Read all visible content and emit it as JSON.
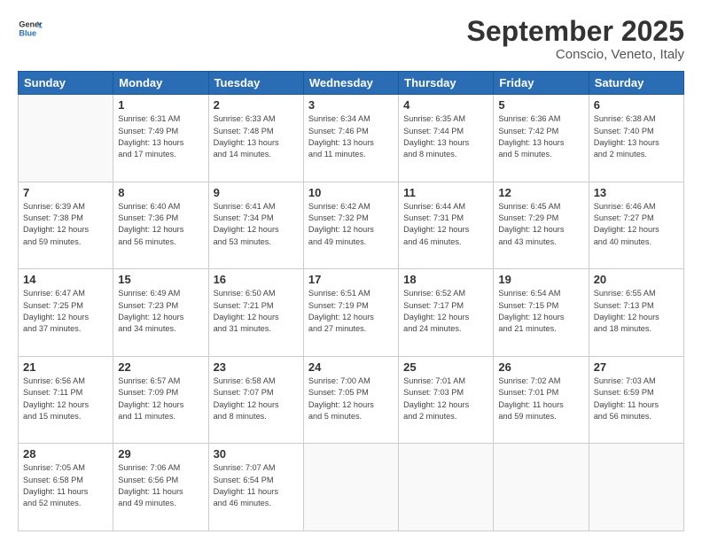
{
  "header": {
    "logo_general": "General",
    "logo_blue": "Blue",
    "month_title": "September 2025",
    "location": "Conscio, Veneto, Italy"
  },
  "days_of_week": [
    "Sunday",
    "Monday",
    "Tuesday",
    "Wednesday",
    "Thursday",
    "Friday",
    "Saturday"
  ],
  "weeks": [
    [
      {
        "day": "",
        "info": ""
      },
      {
        "day": "1",
        "info": "Sunrise: 6:31 AM\nSunset: 7:49 PM\nDaylight: 13 hours\nand 17 minutes."
      },
      {
        "day": "2",
        "info": "Sunrise: 6:33 AM\nSunset: 7:48 PM\nDaylight: 13 hours\nand 14 minutes."
      },
      {
        "day": "3",
        "info": "Sunrise: 6:34 AM\nSunset: 7:46 PM\nDaylight: 13 hours\nand 11 minutes."
      },
      {
        "day": "4",
        "info": "Sunrise: 6:35 AM\nSunset: 7:44 PM\nDaylight: 13 hours\nand 8 minutes."
      },
      {
        "day": "5",
        "info": "Sunrise: 6:36 AM\nSunset: 7:42 PM\nDaylight: 13 hours\nand 5 minutes."
      },
      {
        "day": "6",
        "info": "Sunrise: 6:38 AM\nSunset: 7:40 PM\nDaylight: 13 hours\nand 2 minutes."
      }
    ],
    [
      {
        "day": "7",
        "info": "Sunrise: 6:39 AM\nSunset: 7:38 PM\nDaylight: 12 hours\nand 59 minutes."
      },
      {
        "day": "8",
        "info": "Sunrise: 6:40 AM\nSunset: 7:36 PM\nDaylight: 12 hours\nand 56 minutes."
      },
      {
        "day": "9",
        "info": "Sunrise: 6:41 AM\nSunset: 7:34 PM\nDaylight: 12 hours\nand 53 minutes."
      },
      {
        "day": "10",
        "info": "Sunrise: 6:42 AM\nSunset: 7:32 PM\nDaylight: 12 hours\nand 49 minutes."
      },
      {
        "day": "11",
        "info": "Sunrise: 6:44 AM\nSunset: 7:31 PM\nDaylight: 12 hours\nand 46 minutes."
      },
      {
        "day": "12",
        "info": "Sunrise: 6:45 AM\nSunset: 7:29 PM\nDaylight: 12 hours\nand 43 minutes."
      },
      {
        "day": "13",
        "info": "Sunrise: 6:46 AM\nSunset: 7:27 PM\nDaylight: 12 hours\nand 40 minutes."
      }
    ],
    [
      {
        "day": "14",
        "info": "Sunrise: 6:47 AM\nSunset: 7:25 PM\nDaylight: 12 hours\nand 37 minutes."
      },
      {
        "day": "15",
        "info": "Sunrise: 6:49 AM\nSunset: 7:23 PM\nDaylight: 12 hours\nand 34 minutes."
      },
      {
        "day": "16",
        "info": "Sunrise: 6:50 AM\nSunset: 7:21 PM\nDaylight: 12 hours\nand 31 minutes."
      },
      {
        "day": "17",
        "info": "Sunrise: 6:51 AM\nSunset: 7:19 PM\nDaylight: 12 hours\nand 27 minutes."
      },
      {
        "day": "18",
        "info": "Sunrise: 6:52 AM\nSunset: 7:17 PM\nDaylight: 12 hours\nand 24 minutes."
      },
      {
        "day": "19",
        "info": "Sunrise: 6:54 AM\nSunset: 7:15 PM\nDaylight: 12 hours\nand 21 minutes."
      },
      {
        "day": "20",
        "info": "Sunrise: 6:55 AM\nSunset: 7:13 PM\nDaylight: 12 hours\nand 18 minutes."
      }
    ],
    [
      {
        "day": "21",
        "info": "Sunrise: 6:56 AM\nSunset: 7:11 PM\nDaylight: 12 hours\nand 15 minutes."
      },
      {
        "day": "22",
        "info": "Sunrise: 6:57 AM\nSunset: 7:09 PM\nDaylight: 12 hours\nand 11 minutes."
      },
      {
        "day": "23",
        "info": "Sunrise: 6:58 AM\nSunset: 7:07 PM\nDaylight: 12 hours\nand 8 minutes."
      },
      {
        "day": "24",
        "info": "Sunrise: 7:00 AM\nSunset: 7:05 PM\nDaylight: 12 hours\nand 5 minutes."
      },
      {
        "day": "25",
        "info": "Sunrise: 7:01 AM\nSunset: 7:03 PM\nDaylight: 12 hours\nand 2 minutes."
      },
      {
        "day": "26",
        "info": "Sunrise: 7:02 AM\nSunset: 7:01 PM\nDaylight: 11 hours\nand 59 minutes."
      },
      {
        "day": "27",
        "info": "Sunrise: 7:03 AM\nSunset: 6:59 PM\nDaylight: 11 hours\nand 56 minutes."
      }
    ],
    [
      {
        "day": "28",
        "info": "Sunrise: 7:05 AM\nSunset: 6:58 PM\nDaylight: 11 hours\nand 52 minutes."
      },
      {
        "day": "29",
        "info": "Sunrise: 7:06 AM\nSunset: 6:56 PM\nDaylight: 11 hours\nand 49 minutes."
      },
      {
        "day": "30",
        "info": "Sunrise: 7:07 AM\nSunset: 6:54 PM\nDaylight: 11 hours\nand 46 minutes."
      },
      {
        "day": "",
        "info": ""
      },
      {
        "day": "",
        "info": ""
      },
      {
        "day": "",
        "info": ""
      },
      {
        "day": "",
        "info": ""
      }
    ]
  ]
}
